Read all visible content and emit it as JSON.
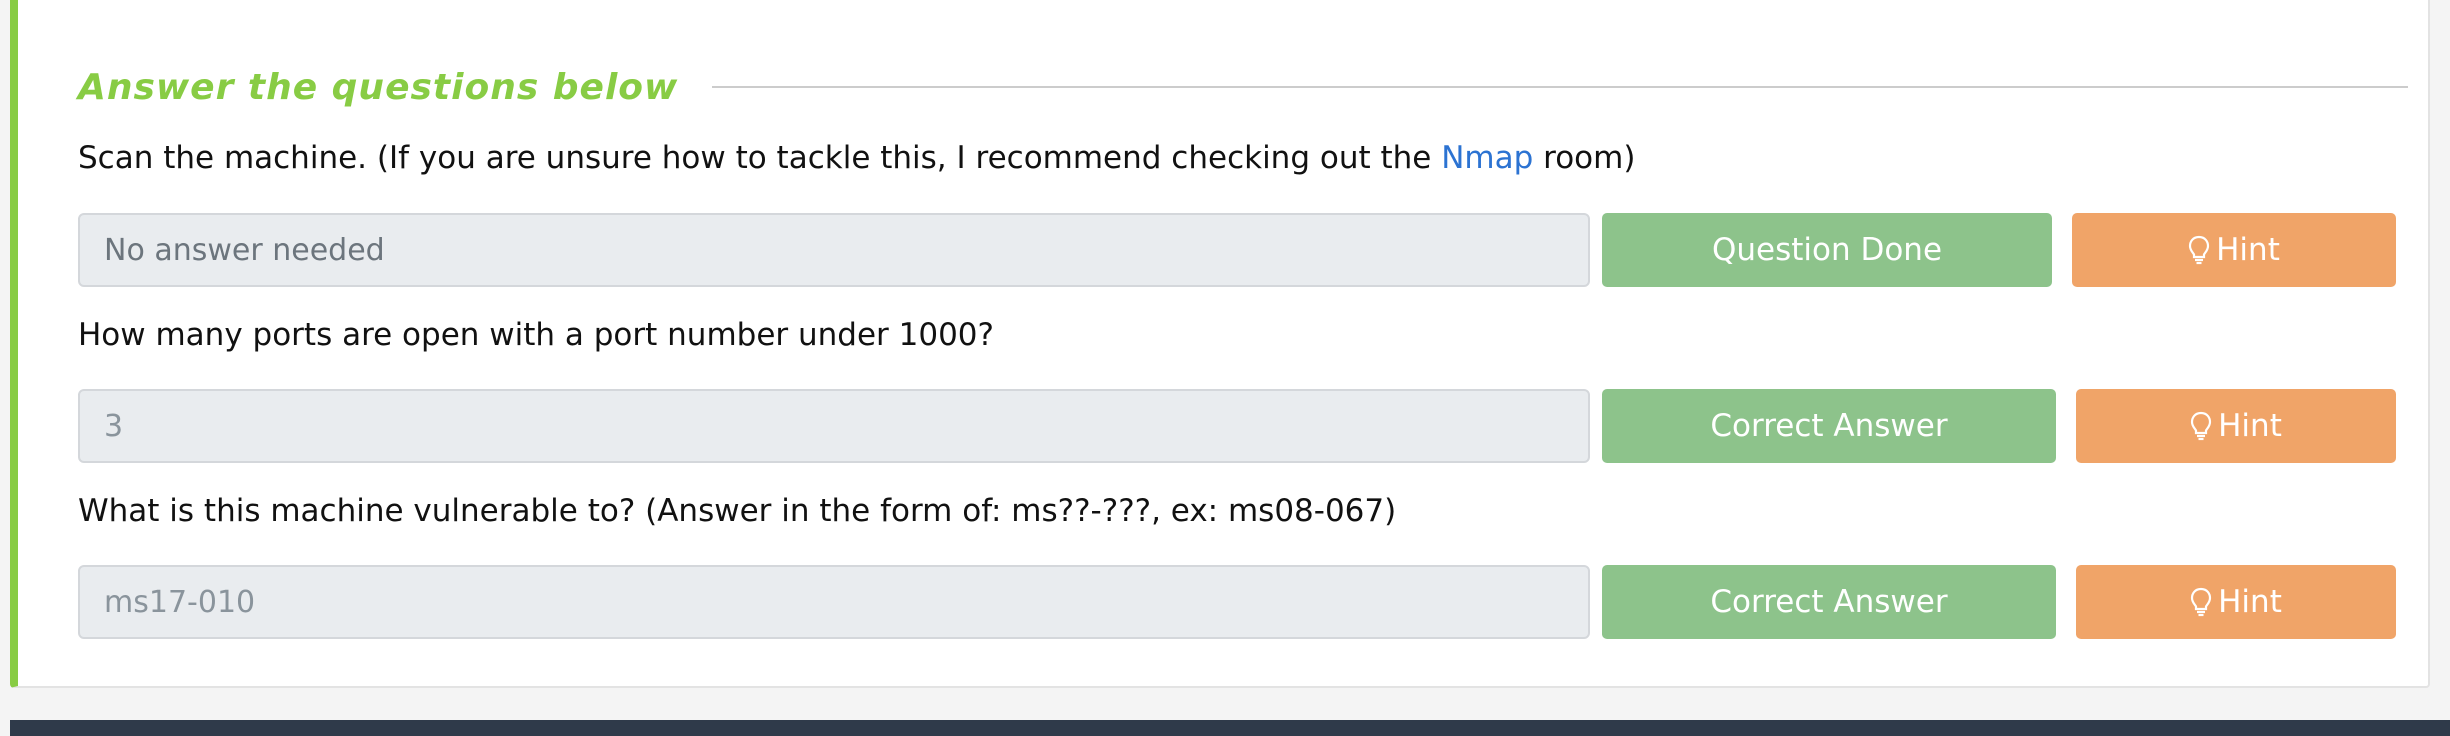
{
  "section": {
    "heading": "Answer the questions below"
  },
  "questions": [
    {
      "text_before": "Scan the machine. (If you are unsure how to tackle this, I recommend checking out the ",
      "link_text": "Nmap",
      "text_after": " room)",
      "answer_value": "No answer needed",
      "submit_label": "Question Done",
      "hint_label": "Hint"
    },
    {
      "text": "How many ports are open with a port number under 1000?",
      "answer_value": "3",
      "submit_label": "Correct Answer",
      "hint_label": "Hint"
    },
    {
      "text": "What is this machine vulnerable to? (Answer in the form of: ms??-???, ex: ms08-067)",
      "answer_value": "ms17-010",
      "submit_label": "Correct Answer",
      "hint_label": "Hint"
    }
  ],
  "colors": {
    "accent_green": "#88cc44",
    "submit_green": "#8dc38b",
    "hint_orange": "#f0a468",
    "link_blue": "#2c73d2",
    "footer_dark": "#2f3a4a"
  },
  "icons": {
    "hint": "lightbulb-icon"
  }
}
